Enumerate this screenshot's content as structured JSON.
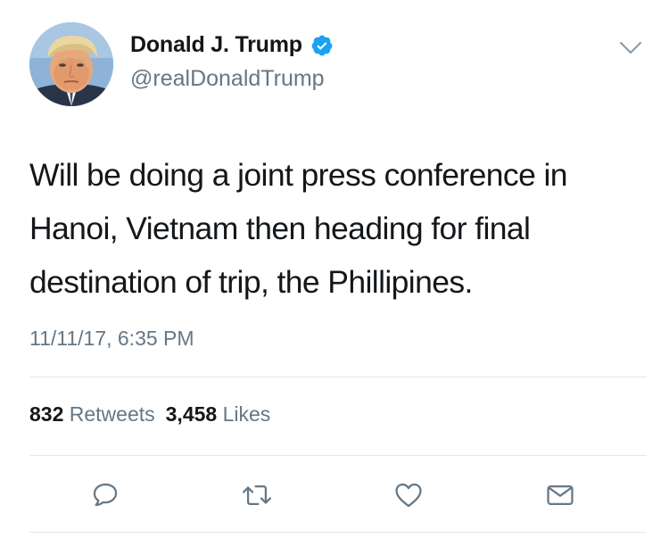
{
  "author": {
    "display_name": "Donald J. Trump",
    "handle": "@realDonaldTrump",
    "verified": true,
    "avatar_icon": "profile-photo"
  },
  "tweet": {
    "text": "Will be doing a joint press conference in\nHanoi, Vietnam then heading for final\ndestination of trip, the Phillipines.",
    "timestamp": "11/11/17, 6:35 PM"
  },
  "stats": {
    "retweets_count": "832",
    "retweets_label": "Retweets",
    "likes_count": "3,458",
    "likes_label": "Likes"
  },
  "actions": [
    "reply-icon",
    "retweet-icon",
    "like-icon",
    "message-icon"
  ],
  "colors": {
    "text": "#14171a",
    "secondary": "#657786",
    "verified": "#1da1f2",
    "divider": "#e1e8ed"
  }
}
